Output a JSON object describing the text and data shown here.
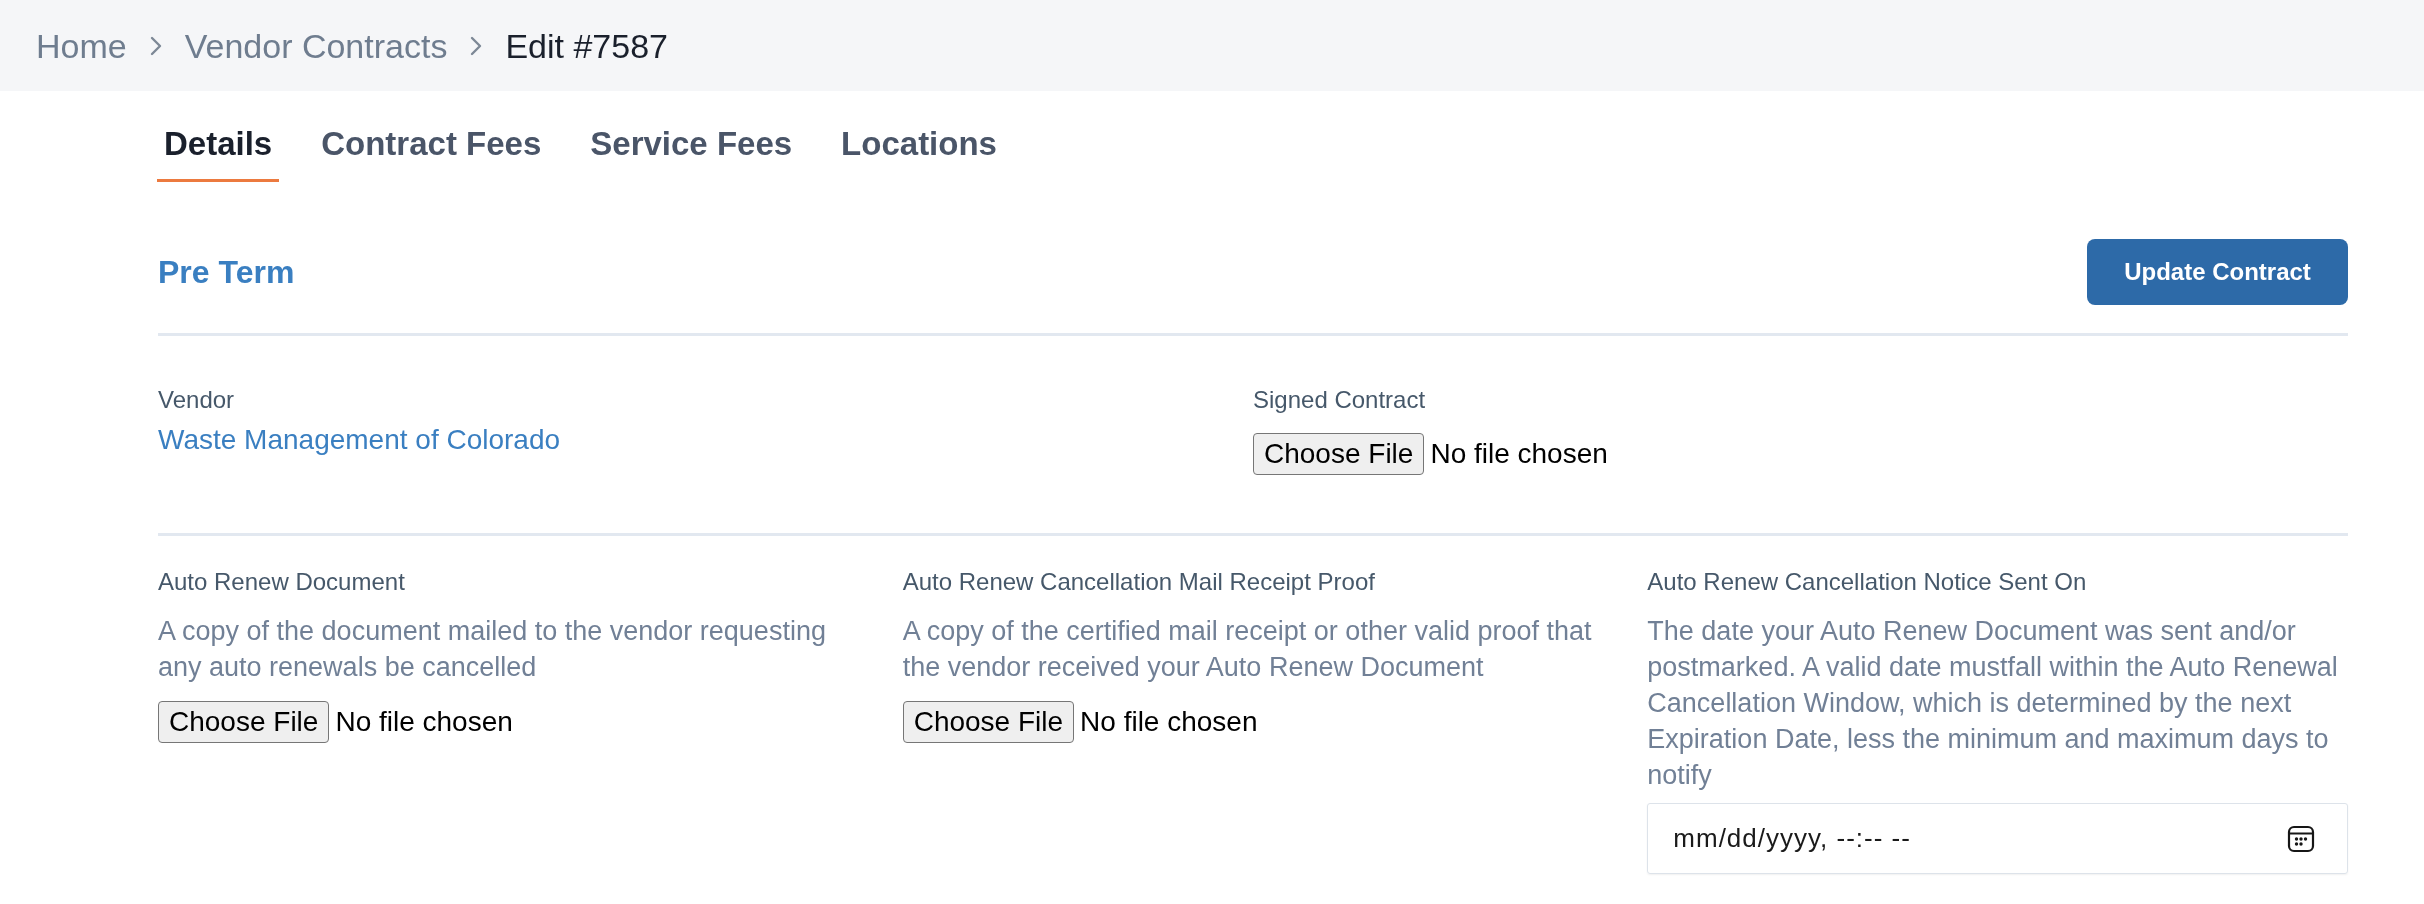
{
  "breadcrumb": [
    {
      "label": "Home",
      "current": false
    },
    {
      "label": "Vendor Contracts",
      "current": false
    },
    {
      "label": "Edit #7587",
      "current": true
    }
  ],
  "tabs": [
    {
      "label": "Details",
      "selected": true
    },
    {
      "label": "Contract Fees",
      "selected": false
    },
    {
      "label": "Service Fees",
      "selected": false
    },
    {
      "label": "Locations",
      "selected": false
    }
  ],
  "section": {
    "title": "Pre Term",
    "action": "Update Contract"
  },
  "top_fields": [
    {
      "kind": "link",
      "label": "Vendor",
      "value": "Waste Management of Colorado"
    },
    {
      "kind": "file",
      "label": "Signed Contract",
      "button": "Choose File",
      "status": "No file chosen"
    }
  ],
  "bottom_fields": [
    {
      "kind": "file",
      "label": "Auto Renew Document",
      "description": "A copy of the document mailed to the vendor requesting any auto renewals be cancelled",
      "button": "Choose File",
      "status": "No file chosen"
    },
    {
      "kind": "file",
      "label": "Auto Renew Cancellation Mail Receipt Proof",
      "description": "A copy of the certified mail receipt or other valid proof that the vendor received your Auto Renew Document",
      "button": "Choose File",
      "status": "No file chosen"
    },
    {
      "kind": "datetime",
      "label": "Auto Renew Cancellation Notice Sent On",
      "description": "The date your Auto Renew Document was sent and/or postmarked. A valid date mustfall within the Auto Renewal Cancellation Window, which is determined by the next Expiration Date, less the minimum and maximum days to notify",
      "placeholder": "mm/dd/yyyy, --:-- --"
    }
  ]
}
